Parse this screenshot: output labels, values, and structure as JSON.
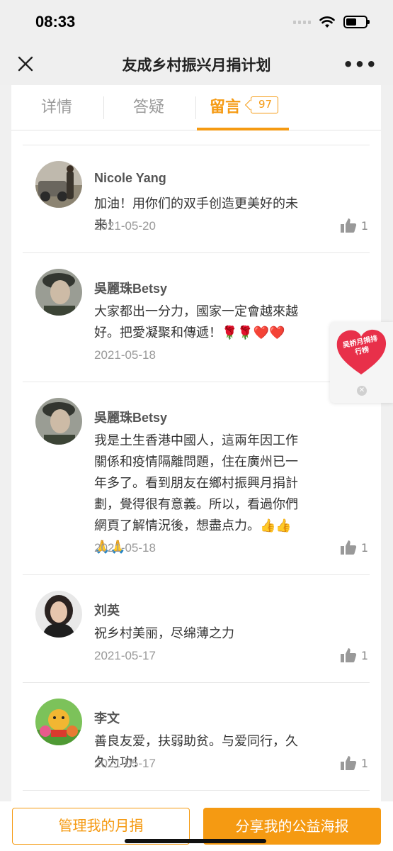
{
  "status": {
    "time": "08:33"
  },
  "nav": {
    "title": "友成乡村振兴月捐计划",
    "more": "•••"
  },
  "tabs": {
    "details": "详情",
    "qa": "答疑",
    "messages": "留言",
    "messages_count": "97"
  },
  "comments": [
    {
      "name": "Nicole Yang",
      "text": "加油！用你们的双手创造更美好的未来！",
      "date": "2021-05-20",
      "likes": "1"
    },
    {
      "name": "吳麗珠Betsy",
      "text": "大家都出一分力，國家一定會越來越好。把愛凝聚和傳遞！🌹🌹❤️❤️",
      "date": "2021-05-18"
    },
    {
      "name": "吳麗珠Betsy",
      "text": "我是土生香港中國人，這兩年因工作關係和疫情隔離問題，住在廣州已一年多了。看到朋友在鄉村振興月捐計劃，覺得很有意義。所以，看過你們網頁了解情況後，想盡点力。👍👍🙏🙏",
      "date": "2021-05-18",
      "likes": "1"
    },
    {
      "name": "刘英",
      "text": "祝乡村美丽，尽绵薄之力",
      "date": "2021-05-17",
      "likes": "1"
    },
    {
      "name": "李文",
      "text": "善良友爱，扶弱助贫。与爱同行，久久为功！",
      "date": "2021-05-17",
      "likes": "1"
    }
  ],
  "float_card": {
    "label": "吴桥月捐排行榜"
  },
  "bottom": {
    "manage": "管理我的月捐",
    "share": "分享我的公益海报"
  },
  "colors": {
    "accent": "#f59a12",
    "heart": "#e8304a"
  }
}
